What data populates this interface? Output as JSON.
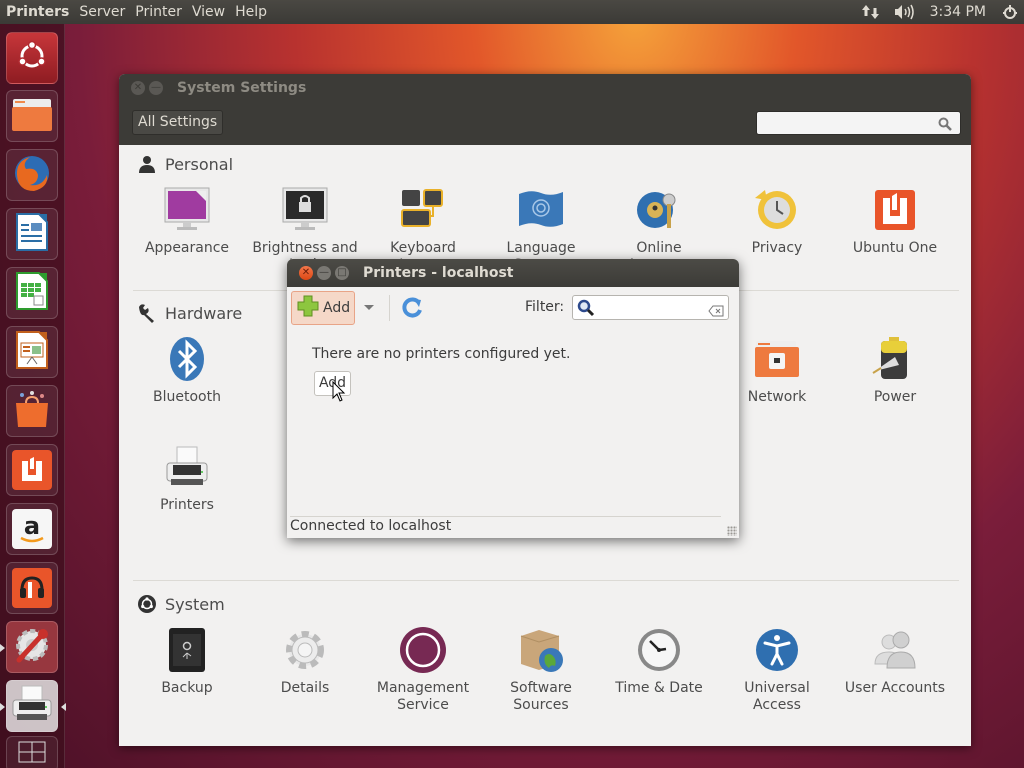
{
  "top_panel": {
    "app_name": "Printers",
    "menus": [
      "Server",
      "Printer",
      "View",
      "Help"
    ],
    "indicators": {
      "network_icon": "network-updown-icon",
      "sound_icon": "volume-icon",
      "clock": "3:34 PM",
      "session_icon": "power-gear-icon"
    }
  },
  "launcher": {
    "items": [
      {
        "name": "dash-home",
        "icon": "ubuntu-logo-icon"
      },
      {
        "name": "files",
        "icon": "folder-icon"
      },
      {
        "name": "firefox",
        "icon": "firefox-icon"
      },
      {
        "name": "libreoffice-writer",
        "icon": "writer-icon"
      },
      {
        "name": "libreoffice-calc",
        "icon": "calc-icon"
      },
      {
        "name": "libreoffice-impress",
        "icon": "impress-icon"
      },
      {
        "name": "software-center",
        "icon": "shopping-bag-icon"
      },
      {
        "name": "ubuntu-one",
        "icon": "ubuntu-one-icon"
      },
      {
        "name": "amazon",
        "icon": "amazon-icon"
      },
      {
        "name": "ubuntu-one-music",
        "icon": "music-headphones-icon"
      },
      {
        "name": "system-settings",
        "icon": "settings-wrench-icon",
        "running": true
      },
      {
        "name": "printers",
        "icon": "printer-icon",
        "running": true,
        "focused": true
      },
      {
        "name": "workspaces",
        "icon": "workspace-switcher-icon"
      }
    ]
  },
  "system_settings": {
    "title": "System Settings",
    "all_settings_label": "All Settings",
    "search_placeholder": "",
    "sections": [
      {
        "title": "Personal",
        "icon": "person-icon",
        "items": [
          {
            "label": "Appearance",
            "icon": "appearance-icon"
          },
          {
            "label": "Brightness and Lock",
            "icon": "brightness-lock-icon"
          },
          {
            "label": "Keyboard Layout",
            "icon": "keyboard-layout-icon"
          },
          {
            "label": "Language Support",
            "icon": "language-flag-icon"
          },
          {
            "label": "Online Accounts",
            "icon": "online-accounts-icon"
          },
          {
            "label": "Privacy",
            "icon": "privacy-clock-icon"
          },
          {
            "label": "Ubuntu One",
            "icon": "ubuntu-one-icon"
          }
        ]
      },
      {
        "title": "Hardware",
        "icon": "wrench-icon",
        "items": [
          {
            "label": "Bluetooth",
            "icon": "bluetooth-icon"
          },
          {
            "label": "Network",
            "icon": "network-folder-icon"
          },
          {
            "label": "Power",
            "icon": "battery-plug-icon"
          },
          {
            "label": "Printers",
            "icon": "printer-icon"
          }
        ]
      },
      {
        "title": "System",
        "icon": "ubuntu-circle-icon",
        "items": [
          {
            "label": "Backup",
            "icon": "safe-icon"
          },
          {
            "label": "Details",
            "icon": "gear-icon"
          },
          {
            "label": "Management Service",
            "icon": "management-ring-icon"
          },
          {
            "label": "Software Sources",
            "icon": "box-globe-icon"
          },
          {
            "label": "Time & Date",
            "icon": "clock-icon"
          },
          {
            "label": "Universal Access",
            "icon": "accessibility-icon"
          },
          {
            "label": "User Accounts",
            "icon": "users-icon"
          }
        ]
      }
    ]
  },
  "printers_dialog": {
    "title": "Printers - localhost",
    "toolbar": {
      "add_label": "Add",
      "filter_label": "Filter:",
      "filter_value": ""
    },
    "empty_message": "There are no printers configured yet.",
    "add_button_label": "Add",
    "status": "Connected to localhost"
  }
}
